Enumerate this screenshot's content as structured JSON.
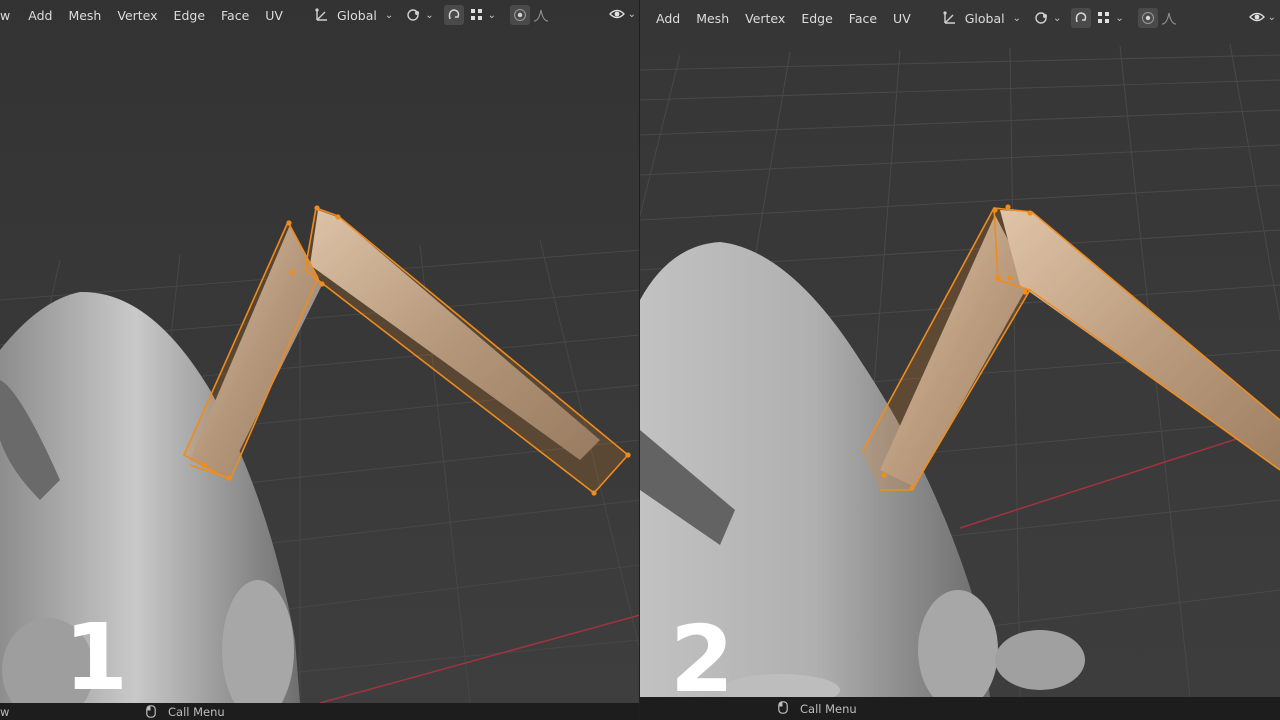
{
  "panels": [
    {
      "number": "1",
      "menu": [
        "w",
        "Add",
        "Mesh",
        "Vertex",
        "Edge",
        "Face",
        "UV"
      ],
      "transform_orientation": "Global",
      "status": {
        "left_fragment": "w",
        "call_menu": "Call Menu"
      }
    },
    {
      "number": "2",
      "menu": [
        "Add",
        "Mesh",
        "Vertex",
        "Edge",
        "Face",
        "UV"
      ],
      "transform_orientation": "Global",
      "status": {
        "call_menu": "Call Menu"
      }
    }
  ],
  "colors": {
    "background": "#3a3a3a",
    "grid": "#4a4a4a",
    "selection": "#f08c1e",
    "x_axis": "#b03a46",
    "mesh": "#b7b7b7"
  },
  "icons": [
    "orientation-icon",
    "pivot-icon",
    "snap-icon",
    "snap-grid-icon",
    "proportional-edit-icon",
    "falloff-icon",
    "overlay-eye-icon"
  ]
}
